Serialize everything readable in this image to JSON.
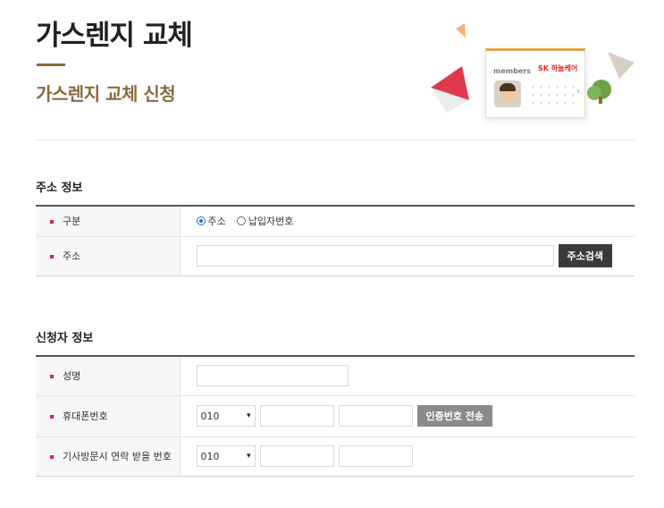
{
  "header": {
    "title": "가스렌지 교체",
    "subtitle": "가스렌지 교체 신청"
  },
  "illustration": {
    "card_label": "members",
    "card_brand": "SK 하늘케어"
  },
  "address_section": {
    "title": "주소 정보",
    "rows": {
      "type_label": "구분",
      "address_label": "주소"
    },
    "radio_options": [
      "주소",
      "납입자번호"
    ],
    "selected_option": "주소",
    "address_value": "",
    "search_button": "주소검색"
  },
  "applicant_section": {
    "title": "신청자 정보",
    "rows": {
      "name_label": "성명",
      "phone_label": "휴대폰번호",
      "visit_phone_label": "기사방문시 연락 받을 번호"
    },
    "name_value": "",
    "phone_prefix": "010",
    "visit_phone_prefix": "010",
    "verify_button": "인증번호 전송"
  },
  "colors": {
    "accent": "#8a6a3c",
    "bullet": "#d8243c",
    "radio": "#1a73e8",
    "dark_button": "#3a3a3a",
    "gray_button": "#8a8a8a"
  }
}
